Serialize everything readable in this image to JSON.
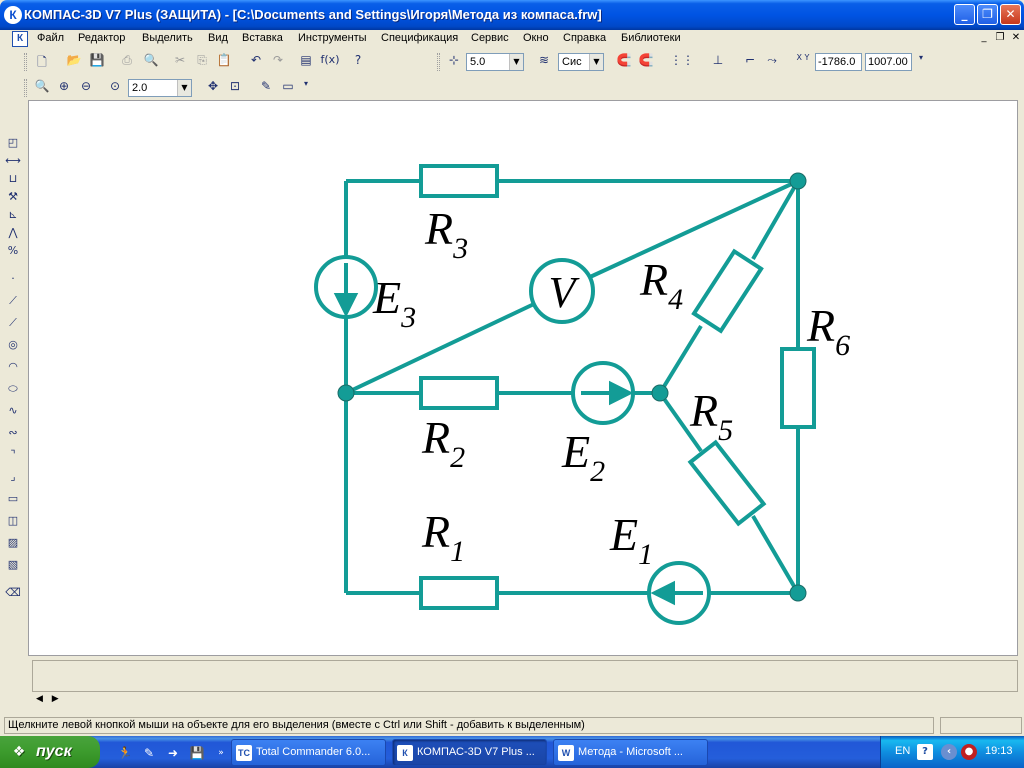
{
  "window": {
    "title": "КОМПАС-3D V7 Plus (ЗАЩИТА) - [C:\\Documents and Settings\\Игоря\\Метода из компаса.frw]",
    "app_icon": "К"
  },
  "menu": [
    "Файл",
    "Редактор",
    "Выделить",
    "Вид",
    "Вставка",
    "Инструменты",
    "Спецификация",
    "Сервис",
    "Окно",
    "Справка",
    "Библиотеки"
  ],
  "toolbar": {
    "step_value": "5.0",
    "layer_value": "Сис",
    "coord_x": "-1786.0",
    "coord_y": "1007.00",
    "fx_label": "f(x)",
    "xy_label": "X Y"
  },
  "view_toolbar": {
    "zoom_value": "2.0"
  },
  "circuit": {
    "labels": {
      "R1": {
        "main": "R",
        "sub": "1"
      },
      "R2": {
        "main": "R",
        "sub": "2"
      },
      "R3": {
        "main": "R",
        "sub": "3"
      },
      "R4": {
        "main": "R",
        "sub": "4"
      },
      "R5": {
        "main": "R",
        "sub": "5"
      },
      "R6": {
        "main": "R",
        "sub": "6"
      },
      "E1": {
        "main": "E",
        "sub": "1"
      },
      "E2": {
        "main": "E",
        "sub": "2"
      },
      "E3": {
        "main": "E",
        "sub": "3"
      },
      "V": "V"
    },
    "color": "#139c96"
  },
  "status": {
    "hint": "Щелкните левой кнопкой мыши на объекте для его выделения (вместе с Ctrl или Shift - добавить к выделенным)"
  },
  "taskbar": {
    "start_label": "пуск",
    "tasks": [
      {
        "icon": "TC",
        "label": "Total Commander 6.0...",
        "active": false
      },
      {
        "icon": "К",
        "label": "КОМПАС-3D V7 Plus ...",
        "active": true
      },
      {
        "icon": "W",
        "label": "Метода - Microsoft ...",
        "active": false
      }
    ],
    "lang": "EN",
    "clock": "19:13"
  }
}
